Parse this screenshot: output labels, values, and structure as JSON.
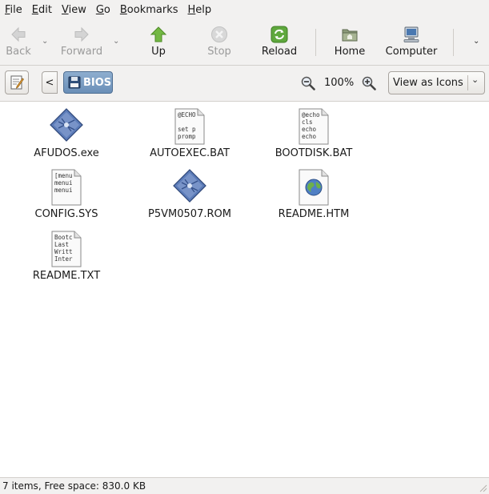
{
  "menubar": {
    "items": [
      {
        "mnemonic": "F",
        "rest": "ile"
      },
      {
        "mnemonic": "E",
        "rest": "dit"
      },
      {
        "mnemonic": "V",
        "rest": "iew"
      },
      {
        "mnemonic": "G",
        "rest": "o"
      },
      {
        "mnemonic": "B",
        "rest": "ookmarks"
      },
      {
        "mnemonic": "H",
        "rest": "elp"
      }
    ]
  },
  "toolbar": {
    "back_label": "Back",
    "forward_label": "Forward",
    "up_label": "Up",
    "stop_label": "Stop",
    "reload_label": "Reload",
    "home_label": "Home",
    "computer_label": "Computer",
    "dropdown_glyph": "⌄",
    "overflow_glyph": "⌄"
  },
  "location": {
    "back_glyph": "<",
    "current_folder": "BIOS",
    "zoom_level": "100%",
    "view_mode": "View as Icons",
    "view_chevron": "⌄"
  },
  "files": [
    {
      "name": "AFUDOS.exe",
      "type": "executable",
      "preview": []
    },
    {
      "name": "AUTOEXEC.BAT",
      "type": "text",
      "preview": [
        "@ECHO",
        "",
        "set p",
        "promp"
      ]
    },
    {
      "name": "BOOTDISK.BAT",
      "type": "text",
      "preview": [
        "@echo",
        "cls",
        "echo",
        "echo"
      ]
    },
    {
      "name": "CONFIG.SYS",
      "type": "text",
      "preview": [
        "[menu",
        "menui",
        "menui",
        ""
      ]
    },
    {
      "name": "P5VM0507.ROM",
      "type": "executable",
      "preview": []
    },
    {
      "name": "README.HTM",
      "type": "html",
      "preview": []
    },
    {
      "name": "README.TXT",
      "type": "text",
      "preview": [
        "Bootc",
        "Last",
        "Writt",
        "Inter"
      ]
    }
  ],
  "status": {
    "text": "7 items, Free space: 830.0 KB"
  },
  "colors": {
    "chrome_bg": "#f2f1f0",
    "path_button": "#7a9cc4",
    "up_arrow": "#6aae3c",
    "reload": "#4e9a34",
    "exe_icon": "#5a78b6"
  }
}
